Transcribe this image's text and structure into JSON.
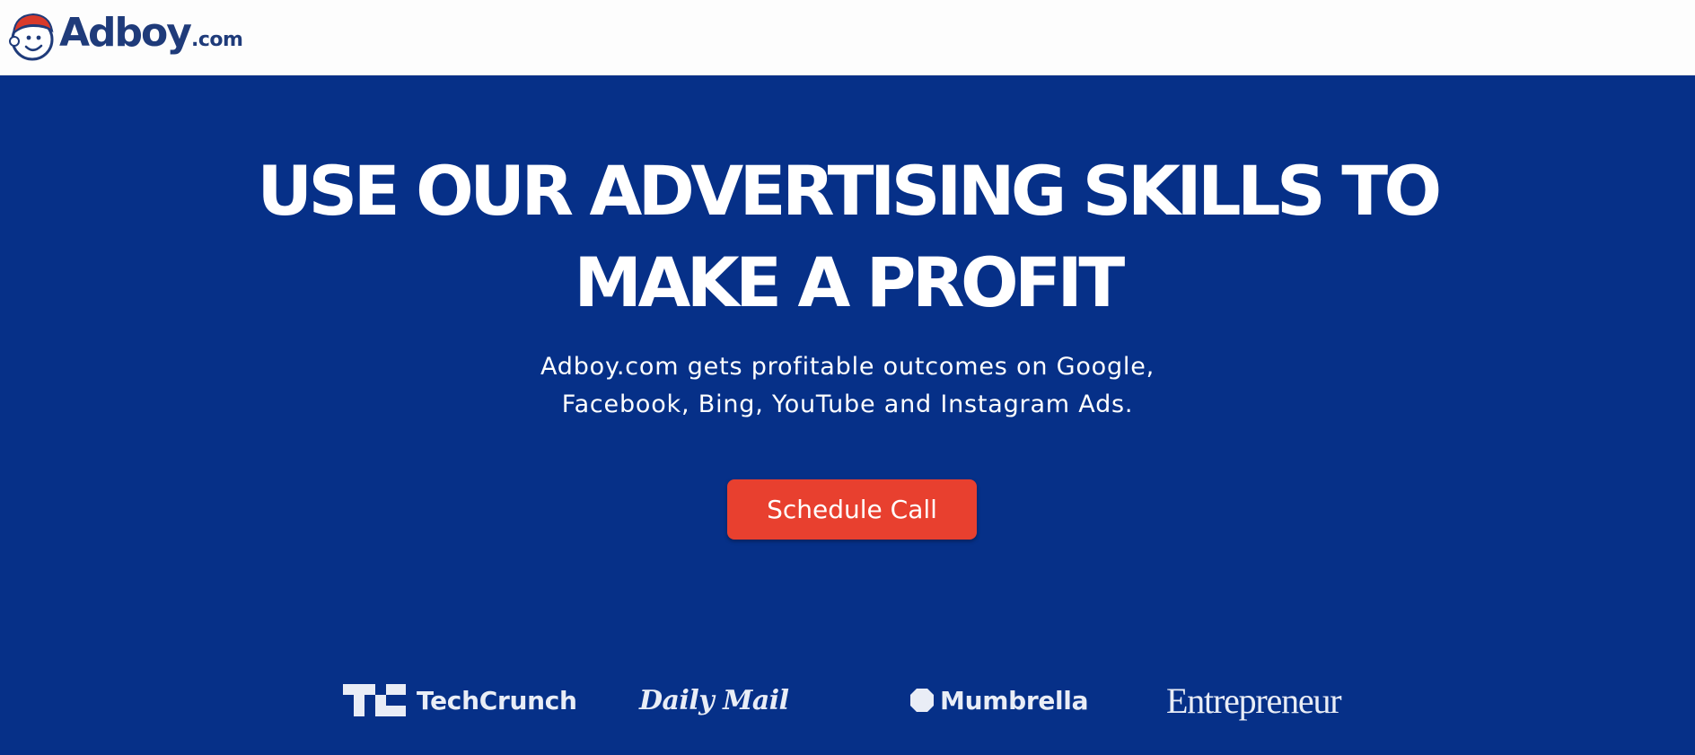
{
  "header": {
    "logo": {
      "word": "Adboy",
      "tld": ".com",
      "icon": "adboy-mascot-icon"
    }
  },
  "hero": {
    "headline_lines": [
      "USE OUR ADVERTISING SKILLS TO",
      "MAKE A PROFIT"
    ],
    "subhead_lines": [
      "Adboy.com gets profitable outcomes on Google,",
      "Facebook, Bing, YouTube and Instagram Ads."
    ],
    "cta_label": "Schedule Call"
  },
  "press": [
    {
      "name": "TechCrunch",
      "icon": "techcrunch-tc-icon"
    },
    {
      "name": "Daily Mail",
      "icon": "dailymail-crest-icon"
    },
    {
      "name": "Mumbrella",
      "icon": "mumbrella-circle-icon"
    },
    {
      "name": "Entrepreneur"
    }
  ],
  "colors": {
    "hero_background": "#063088",
    "cta_background": "#e8402f",
    "logo_navy": "#1f3b7a",
    "logo_cap_red": "#d93a2b",
    "header_background": "#fdfdfd"
  }
}
